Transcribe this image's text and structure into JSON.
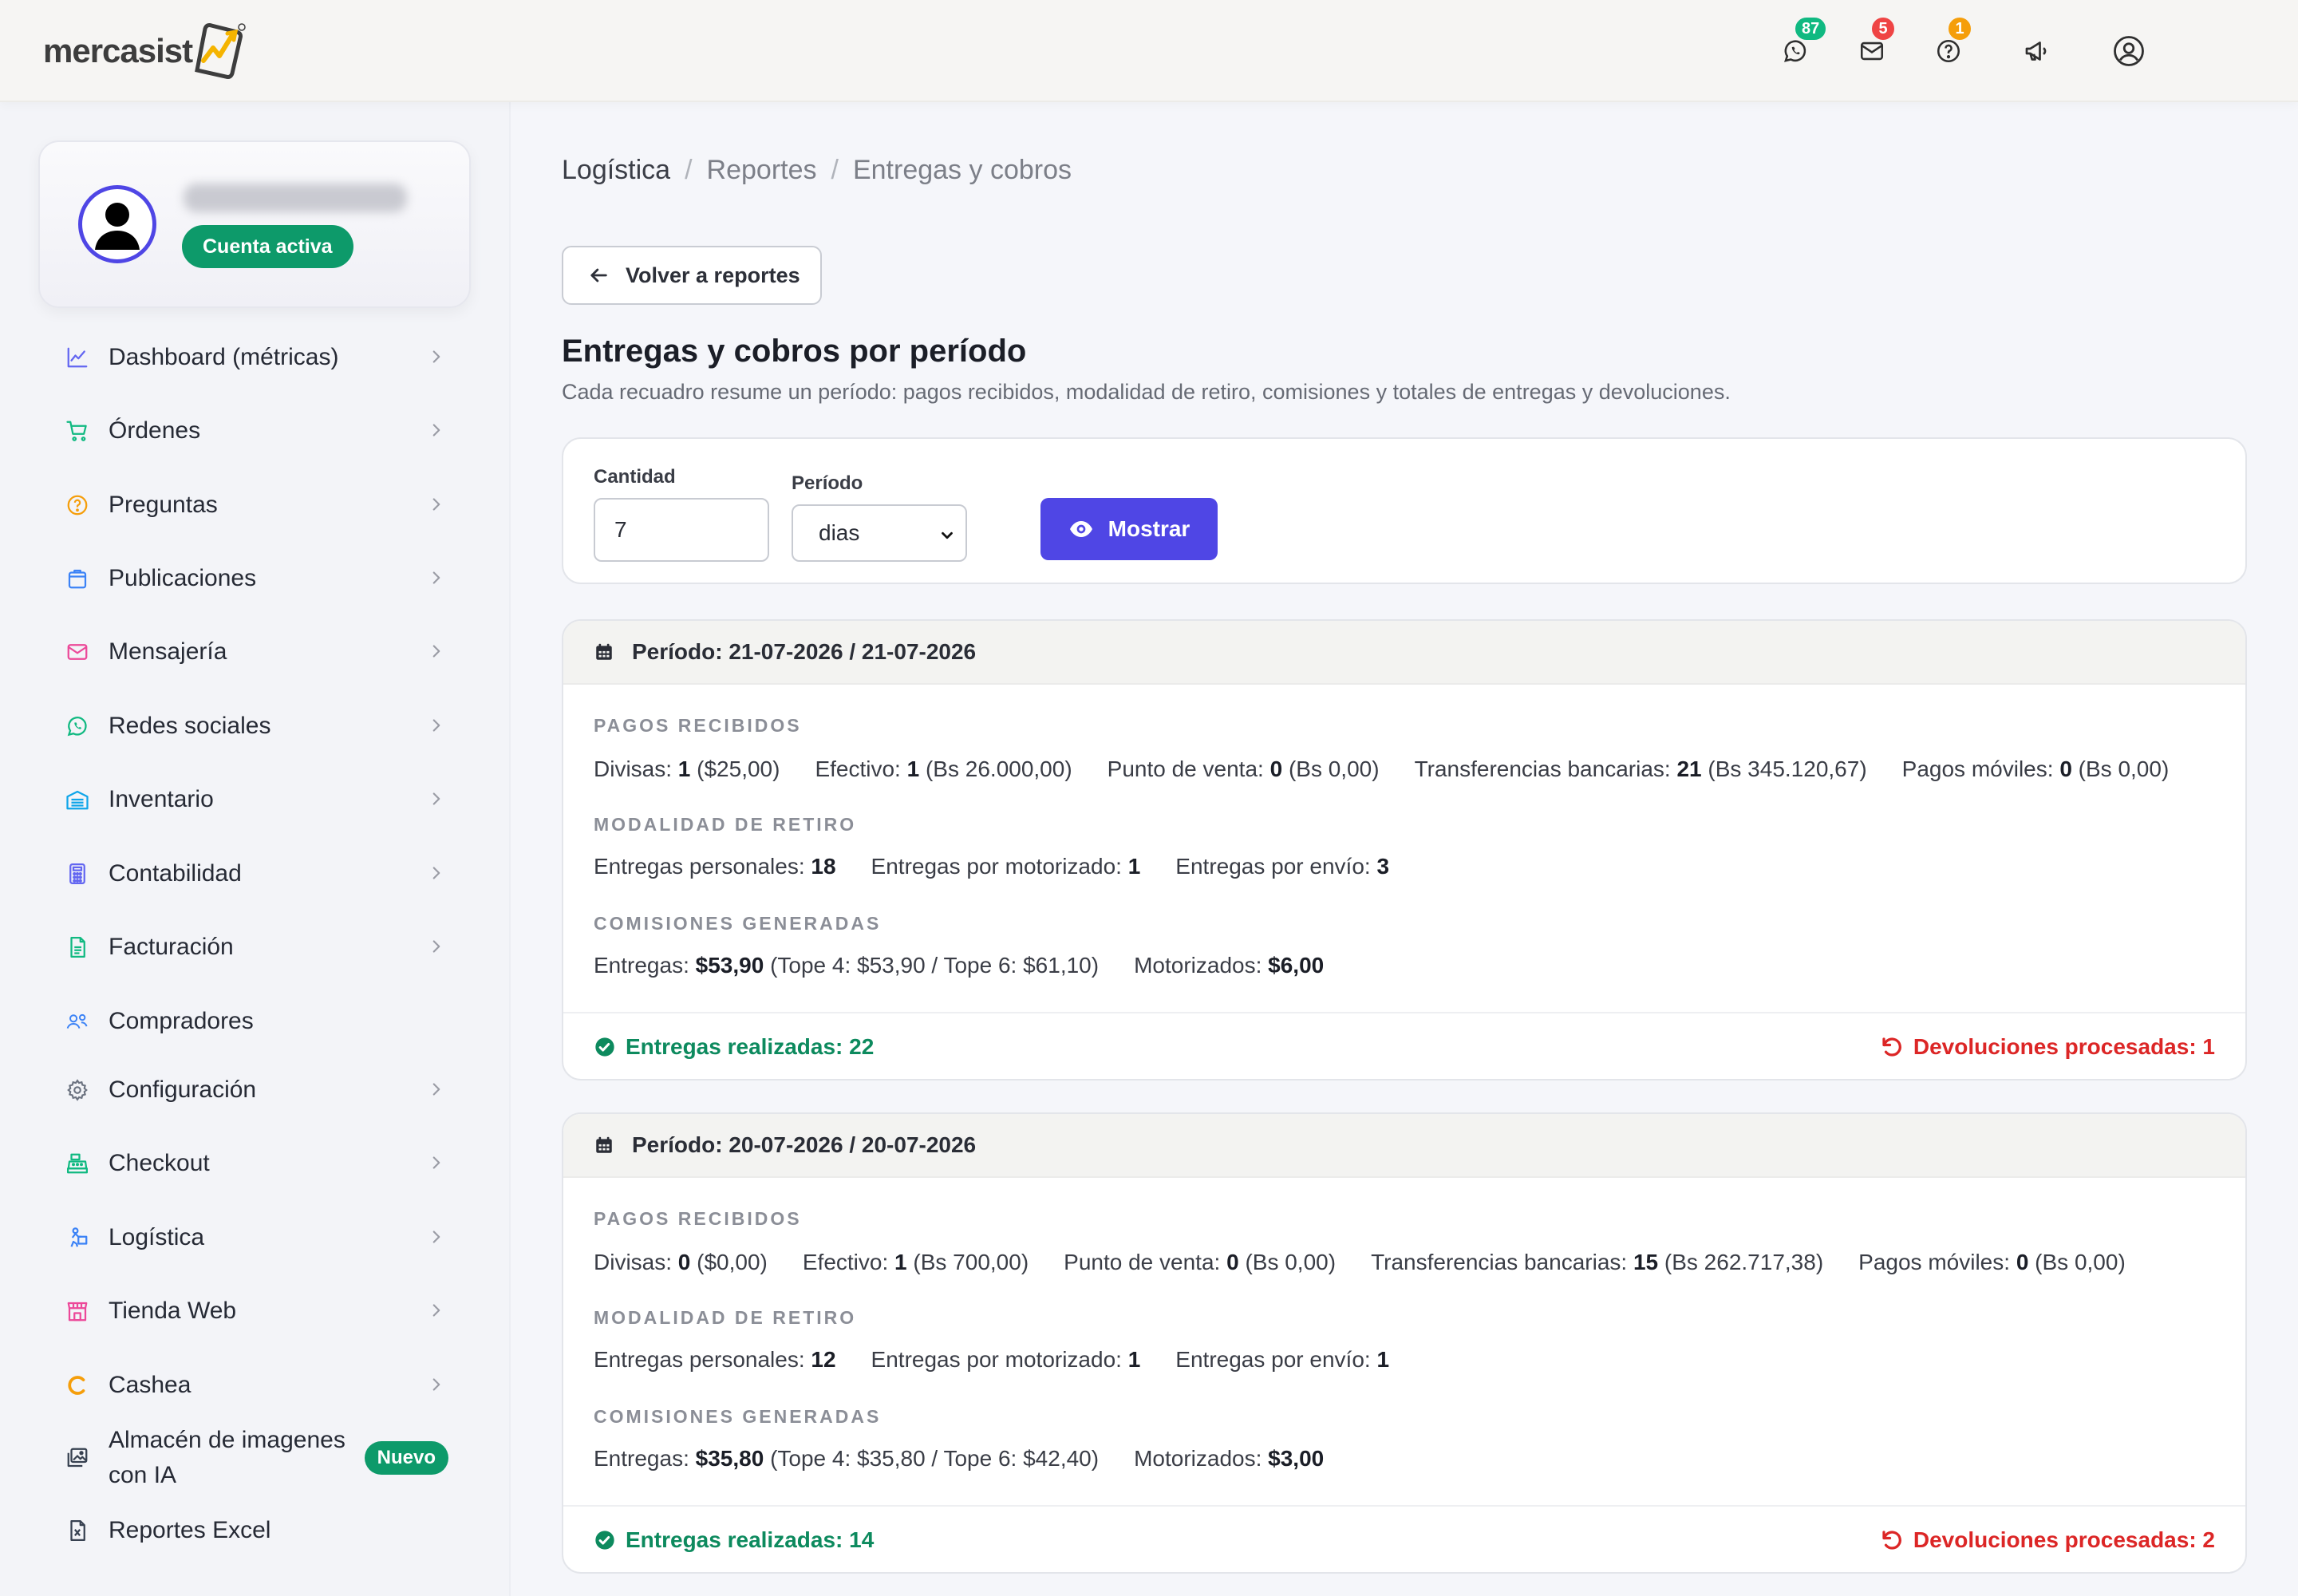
{
  "brand": {
    "logo_text": "mercasist"
  },
  "header": {
    "badges": {
      "whatsapp": "87",
      "mail": "5",
      "help": "1"
    },
    "icons": [
      "whatsapp-icon",
      "mail-icon",
      "help-icon",
      "megaphone-icon",
      "user-circle-icon"
    ]
  },
  "profile": {
    "status": "Cuenta activa"
  },
  "sidebar": {
    "items": [
      {
        "label": "Dashboard (métricas)",
        "icon": "chart-line-icon",
        "color": "#6366f1"
      },
      {
        "label": "Órdenes",
        "icon": "cart-icon",
        "color": "#10b981"
      },
      {
        "label": "Preguntas",
        "icon": "question-icon",
        "color": "#f59e0b"
      },
      {
        "label": "Publicaciones",
        "icon": "bag-icon",
        "color": "#3b82f6"
      },
      {
        "label": "Mensajería",
        "icon": "mail-icon",
        "color": "#ec4899"
      },
      {
        "label": "Redes sociales",
        "icon": "whatsapp-icon",
        "color": "#10b981"
      },
      {
        "label": "Inventario",
        "icon": "warehouse-icon",
        "color": "#0ea5e9"
      },
      {
        "label": "Contabilidad",
        "icon": "calculator-icon",
        "color": "#6366f1"
      },
      {
        "label": "Facturación",
        "icon": "invoice-icon",
        "color": "#10b981"
      },
      {
        "label": "Compradores",
        "icon": "users-icon",
        "color": "#3b82f6"
      },
      {
        "label": "Configuración",
        "icon": "gear-icon",
        "color": "#6b7280"
      },
      {
        "label": "Checkout",
        "icon": "cash-register-icon",
        "color": "#10b981"
      },
      {
        "label": "Logística",
        "icon": "delivery-icon",
        "color": "#3b82f6"
      },
      {
        "label": "Tienda Web",
        "icon": "store-icon",
        "color": "#ec4899"
      },
      {
        "label": "Cashea",
        "icon": "cashea-icon",
        "color": "#f59e0b"
      },
      {
        "label": "Almacén de imagenes con IA",
        "label_line1": "Almacén de imagenes",
        "label_line2": "con IA",
        "icon": "images-icon",
        "color": "#374151",
        "badge": "Nuevo"
      },
      {
        "label": "Reportes Excel",
        "icon": "excel-icon",
        "color": "#374151"
      }
    ]
  },
  "breadcrumb": [
    "Logística",
    "Reportes",
    "Entregas y cobros"
  ],
  "back_button": "Volver a reportes",
  "page": {
    "title": "Entregas y cobros por período",
    "subtitle": "Cada recuadro resume un período: pagos recibidos, modalidad de retiro, comisiones y totales de entregas y devoluciones."
  },
  "filter": {
    "quantity_label": "Cantidad",
    "quantity_value": "7",
    "period_label": "Período",
    "period_value": "dias",
    "show_button": "Mostrar"
  },
  "labels": {
    "section_payments": "PAGOS RECIBIDOS",
    "section_pickup": "MODALIDAD DE RETIRO",
    "section_commissions": "COMISIONES GENERADAS",
    "divisas": "Divisas:",
    "efectivo": "Efectivo:",
    "punto": "Punto de venta:",
    "transfer": "Transferencias bancarias:",
    "moviles": "Pagos móviles:",
    "personal": "Entregas personales:",
    "moto": "Entregas por motorizado:",
    "envio": "Entregas por envío:",
    "entregas": "Entregas:",
    "motorizados": "Motorizados:"
  },
  "periods": [
    {
      "title": "Período: 21-07-2026 / 21-07-2026",
      "payments": {
        "divisas_n": "1",
        "divisas_amt": "($25,00)",
        "efectivo_n": "1",
        "efectivo_amt": "(Bs 26.000,00)",
        "punto_n": "0",
        "punto_amt": "(Bs 0,00)",
        "transfer_n": "21",
        "transfer_amt": "(Bs 345.120,67)",
        "moviles_n": "0",
        "moviles_amt": "(Bs 0,00)"
      },
      "pickup": {
        "personal": "18",
        "moto": "1",
        "envio": "3"
      },
      "commissions": {
        "entregas": "$53,90",
        "topes": "(Tope 4: $53,90 / Tope 6: $61,10)",
        "motorizados": "$6,00"
      },
      "delivered": "Entregas realizadas: 22",
      "returns": "Devoluciones procesadas: 1"
    },
    {
      "title": "Período: 20-07-2026 / 20-07-2026",
      "payments": {
        "divisas_n": "0",
        "divisas_amt": "($0,00)",
        "efectivo_n": "1",
        "efectivo_amt": "(Bs 700,00)",
        "punto_n": "0",
        "punto_amt": "(Bs 0,00)",
        "transfer_n": "15",
        "transfer_amt": "(Bs 262.717,38)",
        "moviles_n": "0",
        "moviles_amt": "(Bs 0,00)"
      },
      "pickup": {
        "personal": "12",
        "moto": "1",
        "envio": "1"
      },
      "commissions": {
        "entregas": "$35,80",
        "topes": "(Tope 4: $35,80 / Tope 6: $42,40)",
        "motorizados": "$3,00"
      },
      "delivered": "Entregas realizadas: 14",
      "returns": "Devoluciones procesadas: 2"
    }
  ],
  "colors": {
    "accent": "#4f46e5",
    "success": "#0d9a6a",
    "danger": "#dc2626",
    "badge_whatsapp": "#10b981",
    "badge_mail": "#ef4444",
    "badge_help": "#f59e0b"
  }
}
